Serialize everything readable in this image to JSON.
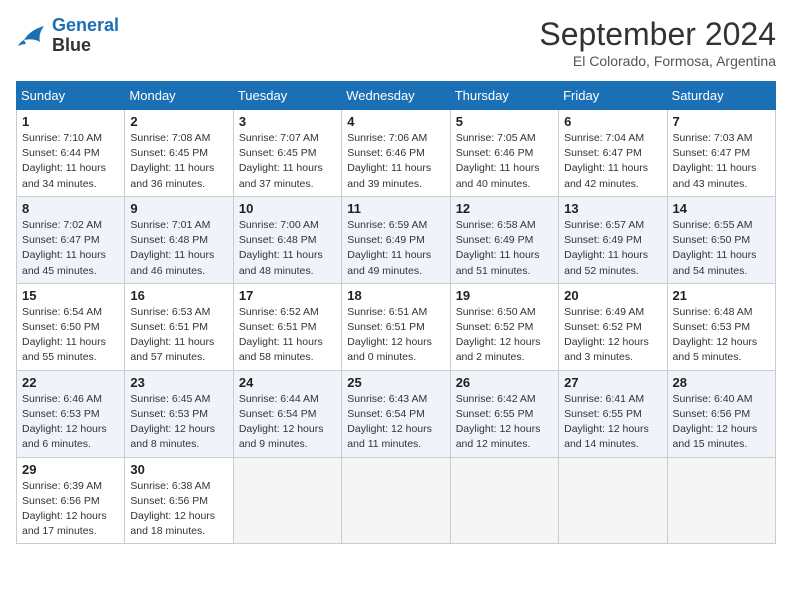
{
  "header": {
    "logo_line1": "General",
    "logo_line2": "Blue",
    "month": "September 2024",
    "location": "El Colorado, Formosa, Argentina"
  },
  "weekdays": [
    "Sunday",
    "Monday",
    "Tuesday",
    "Wednesday",
    "Thursday",
    "Friday",
    "Saturday"
  ],
  "weeks": [
    [
      {
        "day": 1,
        "sunrise": "7:10 AM",
        "sunset": "6:44 PM",
        "daylight": "11 hours and 34 minutes."
      },
      {
        "day": 2,
        "sunrise": "7:08 AM",
        "sunset": "6:45 PM",
        "daylight": "11 hours and 36 minutes."
      },
      {
        "day": 3,
        "sunrise": "7:07 AM",
        "sunset": "6:45 PM",
        "daylight": "11 hours and 37 minutes."
      },
      {
        "day": 4,
        "sunrise": "7:06 AM",
        "sunset": "6:46 PM",
        "daylight": "11 hours and 39 minutes."
      },
      {
        "day": 5,
        "sunrise": "7:05 AM",
        "sunset": "6:46 PM",
        "daylight": "11 hours and 40 minutes."
      },
      {
        "day": 6,
        "sunrise": "7:04 AM",
        "sunset": "6:47 PM",
        "daylight": "11 hours and 42 minutes."
      },
      {
        "day": 7,
        "sunrise": "7:03 AM",
        "sunset": "6:47 PM",
        "daylight": "11 hours and 43 minutes."
      }
    ],
    [
      {
        "day": 8,
        "sunrise": "7:02 AM",
        "sunset": "6:47 PM",
        "daylight": "11 hours and 45 minutes."
      },
      {
        "day": 9,
        "sunrise": "7:01 AM",
        "sunset": "6:48 PM",
        "daylight": "11 hours and 46 minutes."
      },
      {
        "day": 10,
        "sunrise": "7:00 AM",
        "sunset": "6:48 PM",
        "daylight": "11 hours and 48 minutes."
      },
      {
        "day": 11,
        "sunrise": "6:59 AM",
        "sunset": "6:49 PM",
        "daylight": "11 hours and 49 minutes."
      },
      {
        "day": 12,
        "sunrise": "6:58 AM",
        "sunset": "6:49 PM",
        "daylight": "11 hours and 51 minutes."
      },
      {
        "day": 13,
        "sunrise": "6:57 AM",
        "sunset": "6:49 PM",
        "daylight": "11 hours and 52 minutes."
      },
      {
        "day": 14,
        "sunrise": "6:55 AM",
        "sunset": "6:50 PM",
        "daylight": "11 hours and 54 minutes."
      }
    ],
    [
      {
        "day": 15,
        "sunrise": "6:54 AM",
        "sunset": "6:50 PM",
        "daylight": "11 hours and 55 minutes."
      },
      {
        "day": 16,
        "sunrise": "6:53 AM",
        "sunset": "6:51 PM",
        "daylight": "11 hours and 57 minutes."
      },
      {
        "day": 17,
        "sunrise": "6:52 AM",
        "sunset": "6:51 PM",
        "daylight": "11 hours and 58 minutes."
      },
      {
        "day": 18,
        "sunrise": "6:51 AM",
        "sunset": "6:51 PM",
        "daylight": "12 hours and 0 minutes."
      },
      {
        "day": 19,
        "sunrise": "6:50 AM",
        "sunset": "6:52 PM",
        "daylight": "12 hours and 2 minutes."
      },
      {
        "day": 20,
        "sunrise": "6:49 AM",
        "sunset": "6:52 PM",
        "daylight": "12 hours and 3 minutes."
      },
      {
        "day": 21,
        "sunrise": "6:48 AM",
        "sunset": "6:53 PM",
        "daylight": "12 hours and 5 minutes."
      }
    ],
    [
      {
        "day": 22,
        "sunrise": "6:46 AM",
        "sunset": "6:53 PM",
        "daylight": "12 hours and 6 minutes."
      },
      {
        "day": 23,
        "sunrise": "6:45 AM",
        "sunset": "6:53 PM",
        "daylight": "12 hours and 8 minutes."
      },
      {
        "day": 24,
        "sunrise": "6:44 AM",
        "sunset": "6:54 PM",
        "daylight": "12 hours and 9 minutes."
      },
      {
        "day": 25,
        "sunrise": "6:43 AM",
        "sunset": "6:54 PM",
        "daylight": "12 hours and 11 minutes."
      },
      {
        "day": 26,
        "sunrise": "6:42 AM",
        "sunset": "6:55 PM",
        "daylight": "12 hours and 12 minutes."
      },
      {
        "day": 27,
        "sunrise": "6:41 AM",
        "sunset": "6:55 PM",
        "daylight": "12 hours and 14 minutes."
      },
      {
        "day": 28,
        "sunrise": "6:40 AM",
        "sunset": "6:56 PM",
        "daylight": "12 hours and 15 minutes."
      }
    ],
    [
      {
        "day": 29,
        "sunrise": "6:39 AM",
        "sunset": "6:56 PM",
        "daylight": "12 hours and 17 minutes."
      },
      {
        "day": 30,
        "sunrise": "6:38 AM",
        "sunset": "6:56 PM",
        "daylight": "12 hours and 18 minutes."
      },
      null,
      null,
      null,
      null,
      null
    ]
  ]
}
